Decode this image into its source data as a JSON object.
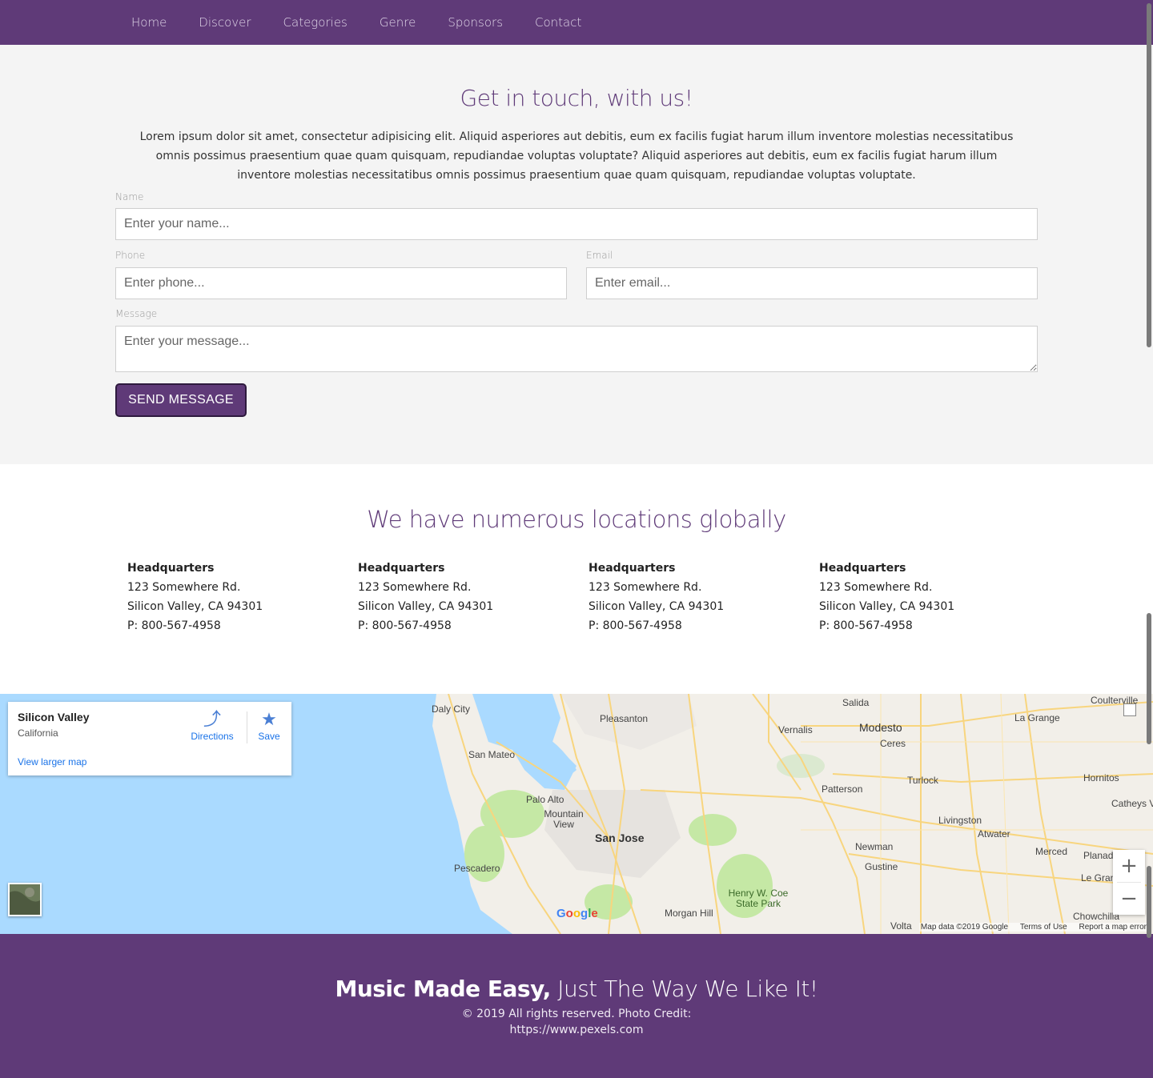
{
  "nav": {
    "items": [
      {
        "label": "Home"
      },
      {
        "label": "Discover"
      },
      {
        "label": "Categories"
      },
      {
        "label": "Genre"
      },
      {
        "label": "Sponsors"
      },
      {
        "label": "Contact"
      }
    ]
  },
  "contact": {
    "title": "Get in touch, with us!",
    "intro": "Lorem ipsum dolor sit amet, consectetur adipisicing elit. Aliquid asperiores aut debitis, eum ex facilis fugiat harum illum inventore molestias necessitatibus omnis possimus praesentium quae quam quisquam, repudiandae voluptas voluptate? Aliquid asperiores aut debitis, eum ex facilis fugiat harum illum inventore molestias necessitatibus omnis possimus praesentium quae quam quisquam, repudiandae voluptas voluptate.",
    "name_label": "Name",
    "name_placeholder": "Enter your name...",
    "phone_label": "Phone",
    "phone_placeholder": "Enter phone...",
    "email_label": "Email",
    "email_placeholder": "Enter email...",
    "message_label": "Message",
    "message_placeholder": "Enter your message...",
    "send_label": "SEND MESSAGE"
  },
  "locations": {
    "title": "We have numerous locations globally",
    "items": [
      {
        "title": "Headquarters",
        "street": "123 Somewhere Rd.",
        "city": "Silicon Valley, CA 94301",
        "phone": "P: 800-567-4958"
      },
      {
        "title": "Headquarters",
        "street": "123 Somewhere Rd.",
        "city": "Silicon Valley, CA 94301",
        "phone": "P: 800-567-4958"
      },
      {
        "title": "Headquarters",
        "street": "123 Somewhere Rd.",
        "city": "Silicon Valley, CA 94301",
        "phone": "P: 800-567-4958"
      },
      {
        "title": "Headquarters",
        "street": "123 Somewhere Rd.",
        "city": "Silicon Valley, CA 94301",
        "phone": "P: 800-567-4958"
      }
    ]
  },
  "map": {
    "card": {
      "place": "Silicon Valley",
      "region": "California",
      "directions": "Directions",
      "save": "Save",
      "larger": "View larger map"
    },
    "labels": {
      "daly_city": "Daly City",
      "pleasanton": "Pleasanton",
      "san_mateo": "San Mateo",
      "palo_alto": "Palo Alto",
      "mountain_view": "Mountain View",
      "san_jose": "San Jose",
      "pescadero": "Pescadero",
      "morgan_hill": "Morgan Hill",
      "henry_coe": "Henry W. Coe State Park",
      "vernalis": "Vernalis",
      "salida": "Salida",
      "modesto": "Modesto",
      "ceres": "Ceres",
      "turlock": "Turlock",
      "patterson": "Patterson",
      "newman": "Newman",
      "gustine": "Gustine",
      "livingston": "Livingston",
      "atwater": "Atwater",
      "merced": "Merced",
      "planada": "Planada",
      "hornitos": "Hornitos",
      "catheys": "Catheys V",
      "la_grange": "La Grange",
      "coulterville": "Coulterville",
      "le_grand": "Le Gran",
      "chowchilla": "Chowchilla",
      "volta": "Volta"
    },
    "zoom_in": "+",
    "zoom_out": "−",
    "attribution": {
      "data": "Map data ©2019 Google",
      "terms": "Terms of Use",
      "report": "Report a map error"
    },
    "logo": "Google",
    "colors": {
      "water": "#aadaff",
      "land": "#f2efe9",
      "park": "#c5e8a5",
      "road": "#f8d57e"
    }
  },
  "footer": {
    "slogan_bold": "Music Made Easy,",
    "slogan_rest": " Just The Way We Like It!",
    "copy_line1": "© 2019 All rights reserved. Photo Credit:",
    "copy_line2": "https://www.pexels.com"
  },
  "theme": {
    "brand": "#5f3a78"
  }
}
